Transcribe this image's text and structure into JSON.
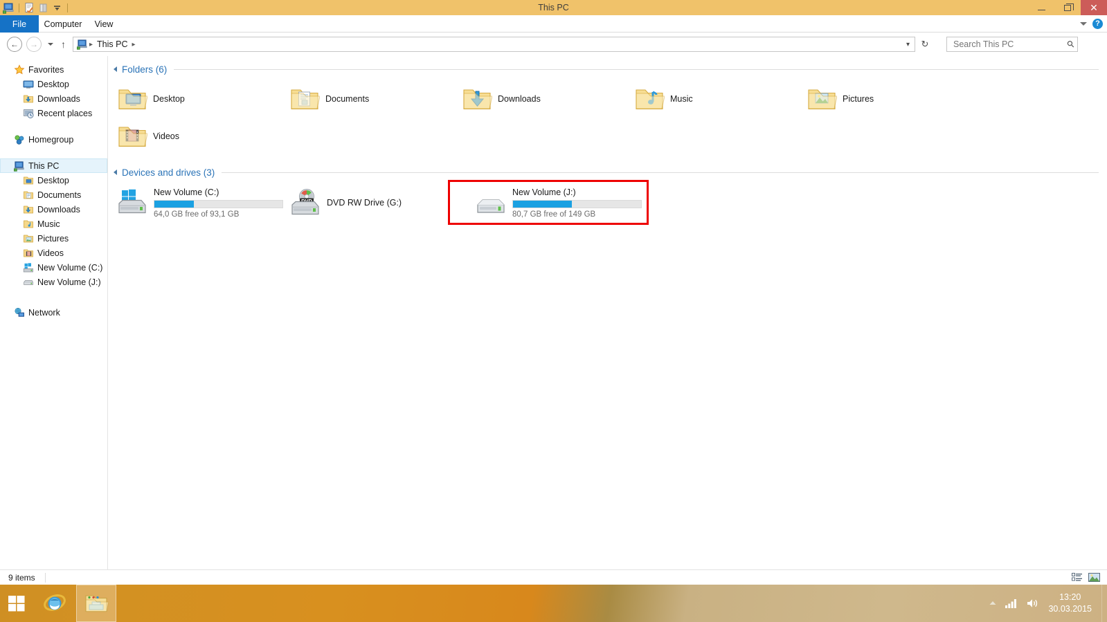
{
  "window": {
    "title": "This PC",
    "quick_access": [
      "this-pc-icon",
      "properties-icon",
      "new-folder-icon",
      "customize-dropdown-icon"
    ],
    "minimize_label": "Minimize",
    "maximize_label": "Restore Down",
    "close_label": "Close"
  },
  "ribbon": {
    "tabs": [
      {
        "label": "File",
        "active": true
      },
      {
        "label": "Computer",
        "active": false
      },
      {
        "label": "View",
        "active": false
      }
    ],
    "expand_label": "Expand the Ribbon",
    "help_label": "?"
  },
  "address": {
    "back_label": "Back",
    "forward_label": "Forward",
    "recent_label": "Recent locations",
    "up_label": "Up",
    "crumbs": [
      "This PC"
    ],
    "refresh_label": "Refresh"
  },
  "search": {
    "placeholder": "Search This PC",
    "value": ""
  },
  "nav_pane": {
    "groups": [
      {
        "name": "Favorites",
        "icon": "star-icon",
        "items": [
          {
            "label": "Desktop",
            "icon": "desktop-icon"
          },
          {
            "label": "Downloads",
            "icon": "downloads-folder-icon"
          },
          {
            "label": "Recent places",
            "icon": "recent-places-icon"
          }
        ]
      },
      {
        "name": "Homegroup",
        "icon": "homegroup-icon",
        "items": []
      },
      {
        "name": "This PC",
        "icon": "this-pc-icon",
        "selected": true,
        "items": [
          {
            "label": "Desktop",
            "icon": "desktop-folder-icon"
          },
          {
            "label": "Documents",
            "icon": "documents-folder-icon"
          },
          {
            "label": "Downloads",
            "icon": "downloads-folder-icon"
          },
          {
            "label": "Music",
            "icon": "music-folder-icon"
          },
          {
            "label": "Pictures",
            "icon": "pictures-folder-icon"
          },
          {
            "label": "Videos",
            "icon": "videos-folder-icon"
          },
          {
            "label": "New Volume (C:)",
            "icon": "windows-drive-icon"
          },
          {
            "label": "New Volume (J:)",
            "icon": "hard-drive-icon"
          }
        ]
      },
      {
        "name": "Network",
        "icon": "network-icon",
        "items": []
      }
    ]
  },
  "main": {
    "folders_group": {
      "title": "Folders (6)",
      "items": [
        {
          "label": "Desktop",
          "icon": "desktop-folder-icon"
        },
        {
          "label": "Documents",
          "icon": "documents-folder-icon"
        },
        {
          "label": "Downloads",
          "icon": "downloads-folder-icon"
        },
        {
          "label": "Music",
          "icon": "music-folder-icon"
        },
        {
          "label": "Pictures",
          "icon": "pictures-folder-icon"
        },
        {
          "label": "Videos",
          "icon": "videos-folder-icon"
        }
      ]
    },
    "drives_group": {
      "title": "Devices and drives (3)",
      "items": [
        {
          "label": "New Volume (C:)",
          "icon": "windows-drive-icon",
          "has_bar": true,
          "used_percent": 31,
          "capacity_text": "64,0 GB free of 93,1 GB",
          "highlighted": false
        },
        {
          "label": "DVD RW Drive (G:)",
          "icon": "dvd-drive-icon",
          "has_bar": false,
          "capacity_text": "",
          "highlighted": false
        },
        {
          "label": "New Volume (J:)",
          "icon": "hard-drive-icon",
          "has_bar": true,
          "used_percent": 46,
          "capacity_text": "80,7 GB free of 149 GB",
          "highlighted": true
        }
      ]
    }
  },
  "statusbar": {
    "item_count": "9 items",
    "details_view_label": "Details view",
    "large_icons_view_label": "Large icons view"
  },
  "taskbar": {
    "start_label": "Start",
    "pinned": [
      {
        "name": "internet-explorer-icon",
        "label": "Internet Explorer"
      },
      {
        "name": "file-explorer-icon",
        "label": "File Explorer",
        "active": true
      }
    ],
    "tray": {
      "show_hidden_label": "Show hidden icons",
      "network_label": "Network",
      "volume_label": "Volume",
      "time": "13:20",
      "date": "30.03.2015"
    }
  },
  "colors": {
    "titlebar": "#f0c26a",
    "accent_blue": "#1572c6",
    "group_header": "#2a73b7",
    "progress_fill": "#1ba1e2",
    "highlight_box": "#ee0000",
    "close_button": "#cc5c59",
    "taskbar_start": "#cf8f23"
  }
}
